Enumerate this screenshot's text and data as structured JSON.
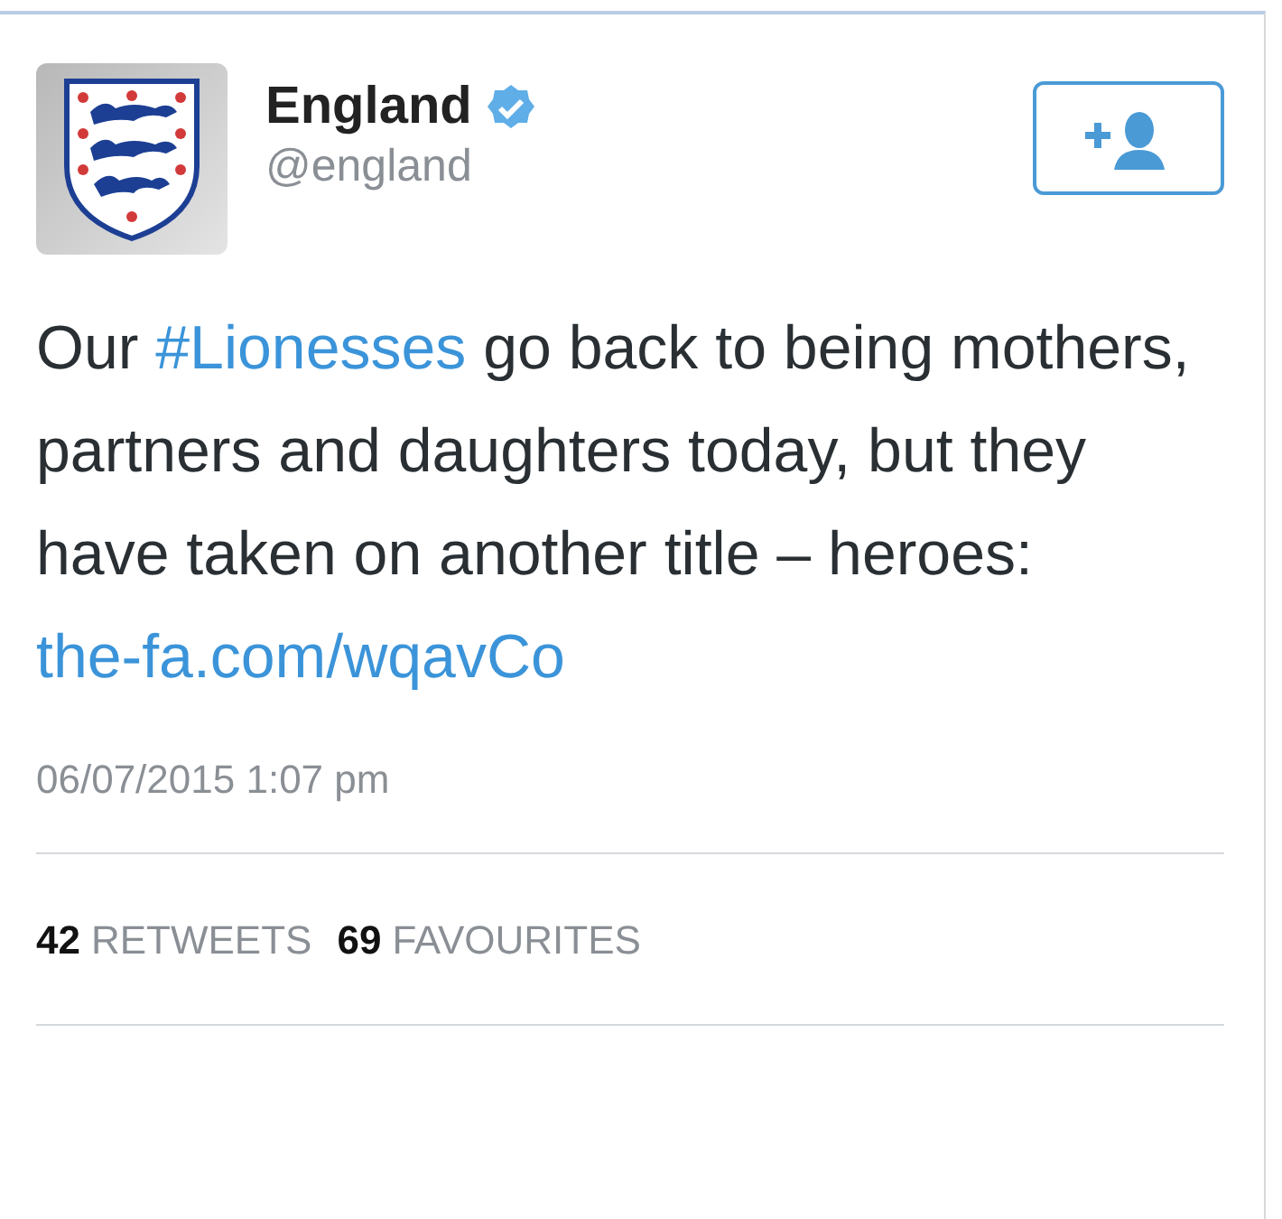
{
  "account": {
    "name": "England",
    "handle": "@england",
    "verified": true
  },
  "follow_button": {
    "kind": "follow"
  },
  "tweet": {
    "segments": [
      {
        "kind": "text",
        "text": "Our "
      },
      {
        "kind": "hashtag",
        "text": "#Lionesses"
      },
      {
        "kind": "text",
        "text": " go back to being mothers, partners and daughters today, but they have taken on another title – heroes: "
      },
      {
        "kind": "link",
        "text": "the-fa.com/"
      },
      {
        "kind": "link",
        "text": "wqavCo"
      }
    ]
  },
  "timestamp": "06/07/2015 1:07 pm",
  "stats": [
    {
      "count": "42",
      "label": "RETWEETS"
    },
    {
      "count": "69",
      "label": "FAVOURITES"
    }
  ]
}
